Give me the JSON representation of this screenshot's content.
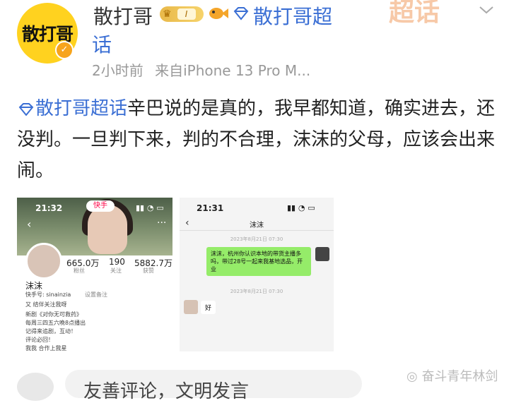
{
  "header": {
    "avatar_text": "散打哥",
    "username": "散打哥",
    "member_level": "I",
    "topic_name_part1": "散打哥超",
    "topic_name_part2": "话",
    "watermark": "超话",
    "time": "2小时前",
    "source": "来自iPhone 13 Pro M..."
  },
  "post": {
    "topic": "散打哥超话",
    "text": "辛巴说的是真的，我早都知道，确实进去，还没判。一旦判下来，判的不合理，沫沫的父母，应该会出来闹。"
  },
  "image1": {
    "time": "21:32",
    "app_badge": "快手",
    "name": "沫沫",
    "stats": [
      {
        "num": "665.0万",
        "label": "粉丝"
      },
      {
        "num": "190",
        "label": "关注"
      },
      {
        "num": "5882.7万",
        "label": "获赞"
      }
    ],
    "id_line": "快手号: sinainzia",
    "tag_line": "设置备注",
    "bio": [
      "又 结伴关注我呀",
      "新剧《对你无可救药》",
      "每周三四五六晚8点播出",
      "记得来追剧，互动！",
      "评论必回！",
      "我我 合作上我星"
    ]
  },
  "image2": {
    "time": "21:31",
    "title": "沫沫",
    "time1": "2023年8月21日 07:30",
    "message_out": "沫沫，杭州你认识本地的带货主播多吗，带过28号一起来我基地选品，开业",
    "time2": "2023年8月21日 07:30",
    "message_in": "好"
  },
  "footer": {
    "comment_placeholder": "友善评论，文明发言",
    "watermark": "奋斗青年林剑"
  },
  "colors": {
    "link": "#3b6fd4",
    "member_gold": "#e9b94a",
    "avatar_yellow": "#ffd21f",
    "bubble_green": "#95ec69"
  },
  "icons": [
    "verified-badge-icon",
    "crown-icon",
    "fish-icon",
    "diamond-topic-icon",
    "chevron-down-icon",
    "back-arrow-icon"
  ]
}
